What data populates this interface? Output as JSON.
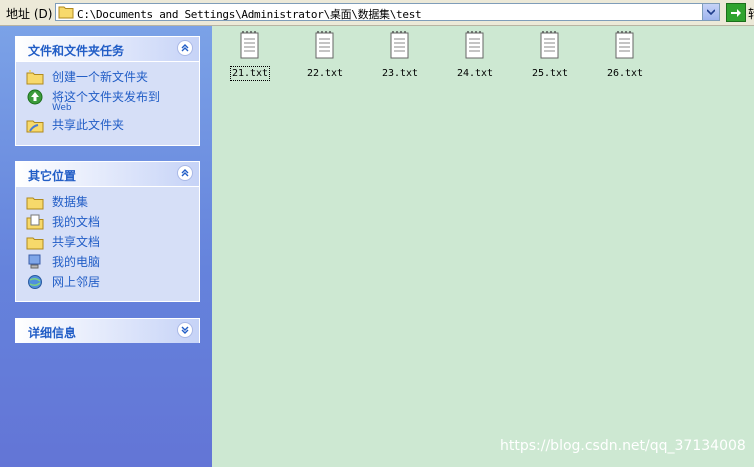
{
  "address": {
    "label": "地址 (D)",
    "path": "C:\\Documents and Settings\\Administrator\\桌面\\数据集\\test",
    "go_label": "转"
  },
  "panels": [
    {
      "title": "文件和文件夹任务",
      "items": [
        {
          "label": "创建一个新文件夹",
          "icon": "new-folder-icon"
        },
        {
          "label": "将这个文件夹发布到",
          "label2": "Web",
          "icon": "publish-web-icon"
        },
        {
          "label": "共享此文件夹",
          "icon": "share-folder-icon"
        }
      ]
    },
    {
      "title": "其它位置",
      "items": [
        {
          "label": "数据集",
          "icon": "folder-icon"
        },
        {
          "label": "我的文档",
          "icon": "my-documents-icon"
        },
        {
          "label": "共享文档",
          "icon": "shared-documents-icon"
        },
        {
          "label": "我的电脑",
          "icon": "my-computer-icon"
        },
        {
          "label": "网上邻居",
          "icon": "network-places-icon"
        }
      ]
    },
    {
      "title": "详细信息",
      "items": []
    }
  ],
  "files": [
    {
      "name": "21.txt",
      "selected": true
    },
    {
      "name": "22.txt"
    },
    {
      "name": "23.txt"
    },
    {
      "name": "24.txt"
    },
    {
      "name": "25.txt"
    },
    {
      "name": "26.txt"
    }
  ],
  "watermark": "https://blog.csdn.net/qq_37134008"
}
